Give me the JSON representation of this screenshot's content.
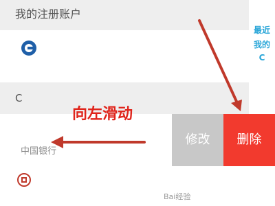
{
  "sections": {
    "registered_title": "我的注册账户",
    "c_title": "C"
  },
  "banks": {
    "boc_label": "中国银行"
  },
  "swipe_actions": {
    "edit": "修改",
    "delete": "删除"
  },
  "side_index": {
    "recent": "最近",
    "mine": "我的",
    "c": "C"
  },
  "annotation": "向左滑动",
  "watermark": "Bai经验",
  "colors": {
    "delete": "#f23a2e",
    "edit": "#c8c8c8",
    "accent_index": "#2aa6d8",
    "annotation": "#e0241b"
  }
}
